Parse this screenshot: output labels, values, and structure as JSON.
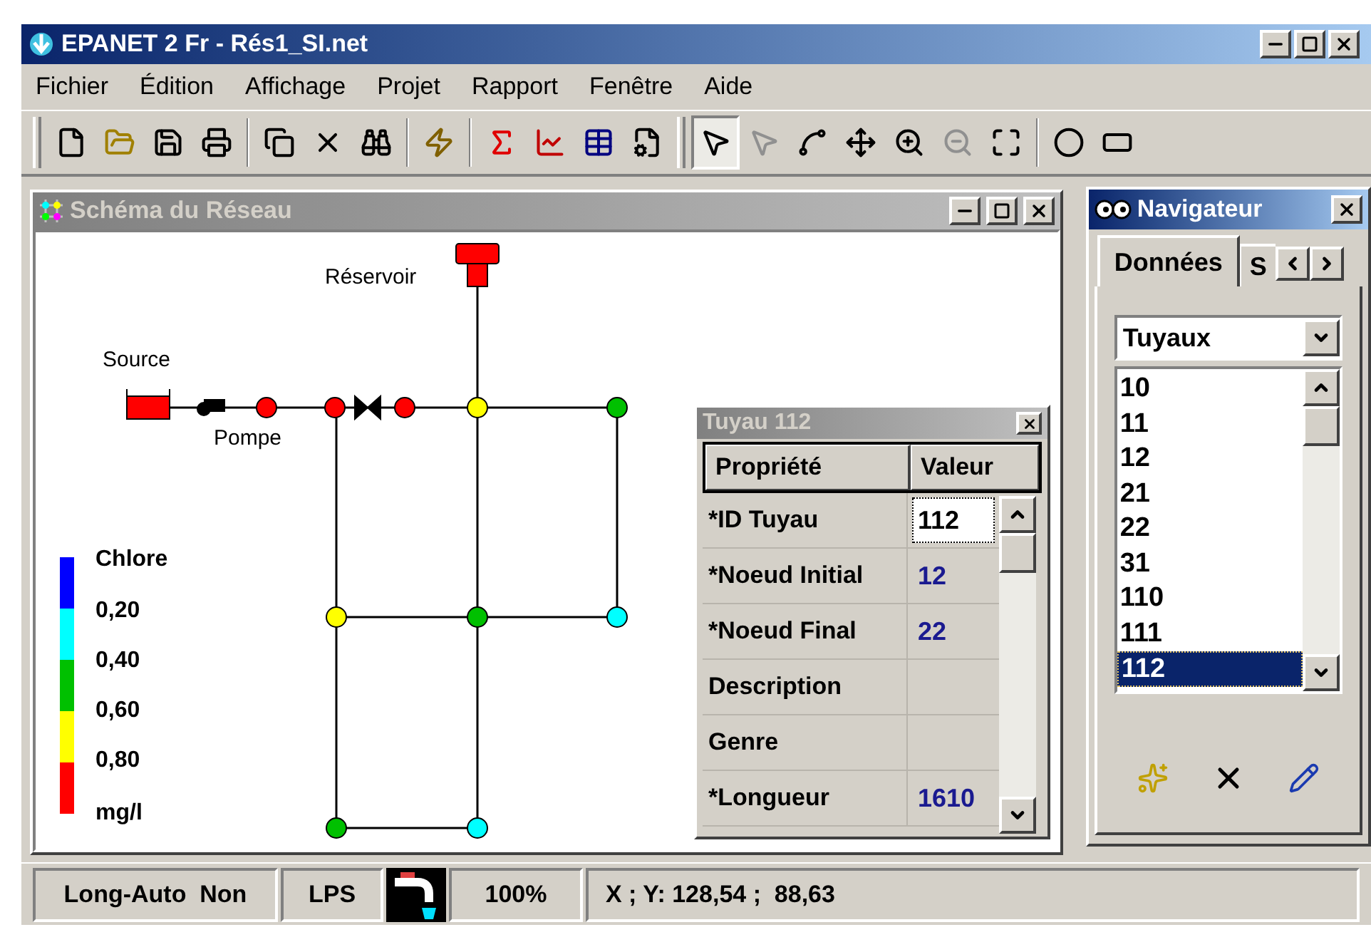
{
  "window": {
    "title": "EPANET 2 Fr - Rés1_SI.net"
  },
  "menu": [
    "Fichier",
    "Édition",
    "Affichage",
    "Projet",
    "Rapport",
    "Fenêtre",
    "Aide"
  ],
  "toolbar": {
    "select_tool_selected": true
  },
  "map_window": {
    "title": "Schéma du Réseau",
    "reservoir": {
      "label": "Réservoir"
    },
    "source": {
      "label": "Source"
    },
    "pump": {
      "label": "Pompe"
    },
    "nodes": [
      {
        "color": "#ff0000"
      },
      {
        "color": "#ff0000"
      },
      {
        "color": "#ff0000"
      },
      {
        "color": "#ffff00"
      },
      {
        "color": "#00c000"
      },
      {
        "color": "#ffff00"
      },
      {
        "color": "#00c000"
      },
      {
        "color": "#00ffff"
      },
      {
        "color": "#00c000"
      },
      {
        "color": "#00ffff"
      }
    ],
    "legend": {
      "title": "Chlore",
      "unit": "mg/l",
      "ticks": [
        "0,20",
        "0,40",
        "0,60",
        "0,80"
      ],
      "colors": [
        {
          "color": "#0000ff"
        },
        {
          "color": "#00ffff"
        },
        {
          "color": "#00c000"
        },
        {
          "color": "#ffff00"
        },
        {
          "color": "#ff0000"
        }
      ]
    }
  },
  "property_window": {
    "title": "Tuyau 112",
    "columns": [
      "Propriété",
      "Valeur"
    ],
    "rows": [
      {
        "property": "*ID Tuyau",
        "value": "112",
        "editing": true
      },
      {
        "property": "*Noeud Initial",
        "value": "12",
        "editing": false
      },
      {
        "property": "*Noeud Final",
        "value": "22",
        "editing": false
      },
      {
        "property": "Description"
      },
      {
        "property": "Genre"
      },
      {
        "property": "*Longueur",
        "value": "1610",
        "editing": false
      }
    ]
  },
  "navigator": {
    "title": "Navigateur",
    "tabs": [
      {
        "label": "Données",
        "selected": true
      },
      {
        "label": "S",
        "selected": false
      }
    ],
    "dropdown": "Tuyaux",
    "items": [
      {
        "label": "10",
        "selected": false
      },
      {
        "label": "11",
        "selected": false
      },
      {
        "label": "12",
        "selected": false
      },
      {
        "label": "21",
        "selected": false
      },
      {
        "label": "22",
        "selected": false
      },
      {
        "label": "31",
        "selected": false
      },
      {
        "label": "110",
        "selected": false
      },
      {
        "label": "111",
        "selected": false
      },
      {
        "label": "112",
        "selected": true
      }
    ]
  },
  "status_bar": [
    "Long-Auto  Non",
    "LPS",
    "100%",
    "X ; Y: 128,54 ;  88,63"
  ]
}
